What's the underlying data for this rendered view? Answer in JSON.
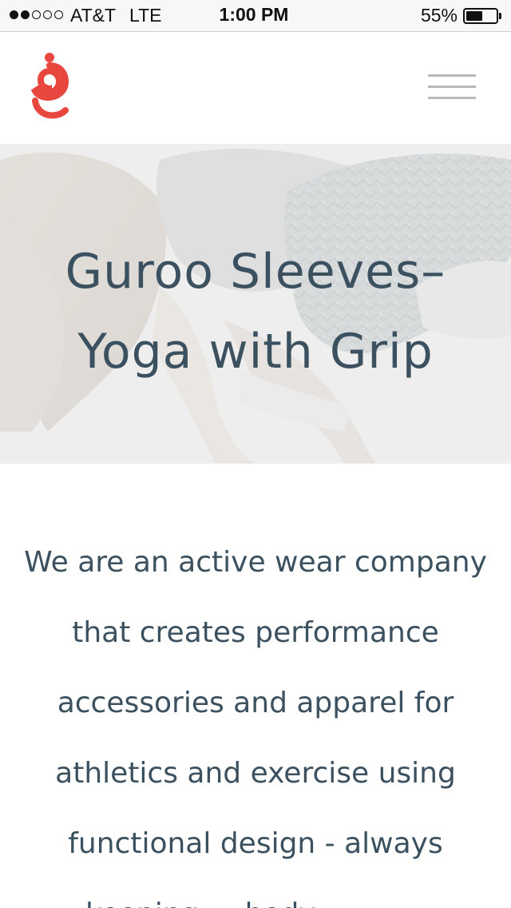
{
  "status_bar": {
    "signal_bars_filled": 2,
    "signal_bars_total": 5,
    "carrier": "AT&T",
    "network": "LTE",
    "time": "1:00 PM",
    "battery_percent": "55%",
    "battery_level": 0.55
  },
  "header": {
    "logo_icon": "guroo-g-logo-icon",
    "menu_icon": "hamburger-menu-icon",
    "brand_color": "#e8473f"
  },
  "hero": {
    "title_line1": "Guroo Sleeves–",
    "title_line2": "Yoga with Grip",
    "text_color": "#3c5160"
  },
  "intro": {
    "lines": [
      "We are an active wear company",
      "that creates performance",
      "accessories and apparel for",
      "athletics and exercise using",
      "functional design - always",
      "... keeping ... body ... ... ... ..."
    ]
  }
}
